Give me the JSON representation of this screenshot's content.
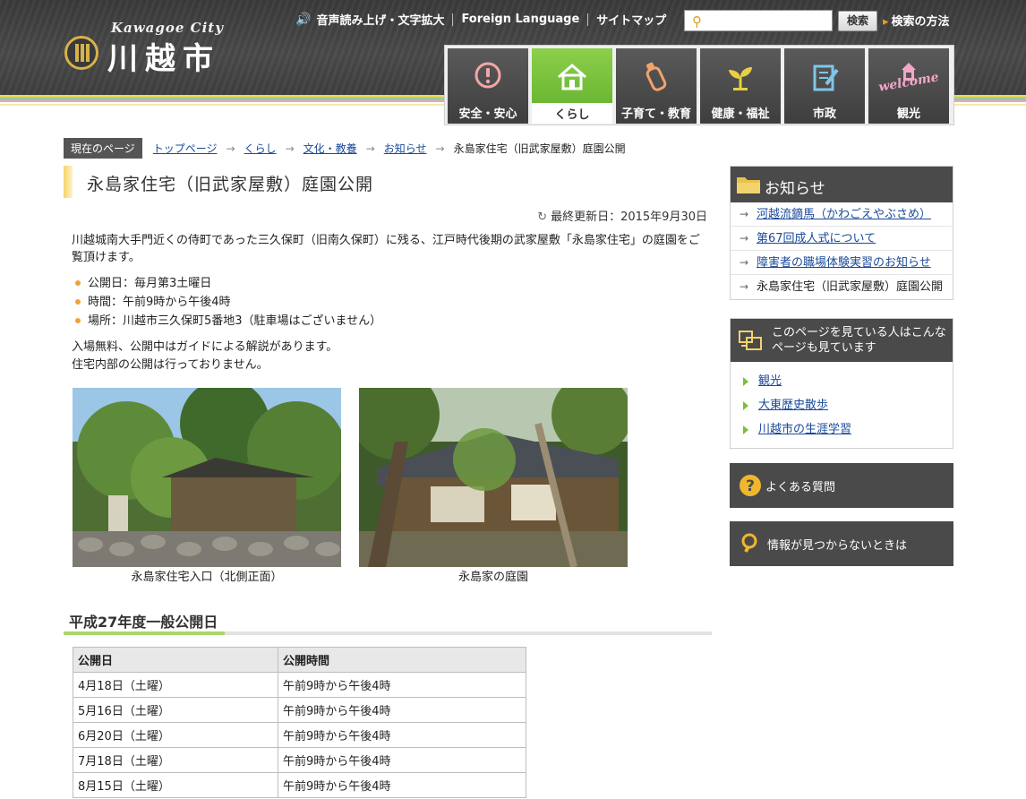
{
  "header": {
    "logo_en": "Kawagoe City",
    "logo_ja": "川越市",
    "util_links": [
      "音声読み上げ・文字拡大",
      "Foreign Language",
      "サイトマップ"
    ],
    "search_placeholder": "",
    "search_button": "検索",
    "search_help": "検索の方法"
  },
  "nav": [
    {
      "label": "安全・安心",
      "icon": "exclamation-icon"
    },
    {
      "label": "くらし",
      "icon": "house-icon",
      "active": true
    },
    {
      "label": "子育て・教育",
      "icon": "baby-bottle-icon"
    },
    {
      "label": "健康・福祉",
      "icon": "sprout-icon"
    },
    {
      "label": "市政",
      "icon": "document-pen-icon"
    },
    {
      "label": "観光",
      "icon": "bell-tower-icon",
      "badge": "welcome"
    }
  ],
  "breadcrumb": {
    "here_label": "現在のページ",
    "items": [
      "トップページ",
      "くらし",
      "文化・教養",
      "お知らせ"
    ],
    "current": "永島家住宅（旧武家屋敷）庭園公開"
  },
  "main": {
    "title": "永島家住宅（旧武家屋敷）庭園公開",
    "updated": "最終更新日：2015年9月30日",
    "intro": "川越城南大手門近くの侍町であった三久保町（旧南久保町）に残る、江戸時代後期の武家屋敷「永島家住宅」の庭園をご覧頂けます。",
    "bullets": [
      "公開日：毎月第3土曜日",
      "時間：午前9時から午後4時",
      "場所：川越市三久保町5番地3（駐車場はございません）"
    ],
    "notes": [
      "入場無料、公開中はガイドによる解説があります。",
      "住宅内部の公開は行っておりません。"
    ],
    "photos": [
      {
        "caption": "永島家住宅入口（北側正面）"
      },
      {
        "caption": "永島家の庭園"
      }
    ],
    "section_title": "平成27年度一般公開日",
    "table": {
      "headers": [
        "公開日",
        "公開時間"
      ],
      "rows": [
        [
          "4月18日（土曜）",
          "午前9時から午後4時"
        ],
        [
          "5月16日（土曜）",
          "午前9時から午後4時"
        ],
        [
          "6月20日（土曜）",
          "午前9時から午後4時"
        ],
        [
          "7月18日（土曜）",
          "午前9時から午後4時"
        ],
        [
          "8月15日（土曜）",
          "午前9時から午後4時"
        ]
      ]
    }
  },
  "sidebar": {
    "news_title": "お知らせ",
    "news": [
      {
        "label": "河越流鏑馬（かわごえやぶさめ）",
        "link": true
      },
      {
        "label": "第67回成人式について",
        "link": true
      },
      {
        "label": "障害者の職場体験実習のお知らせ",
        "link": true
      },
      {
        "label": "永島家住宅（旧武家屋敷）庭園公開",
        "link": false
      }
    ],
    "also_title": "このページを見ている人はこんなページも見ています",
    "also": [
      "観光",
      "大東歴史散歩",
      "川越市の生涯学習"
    ],
    "faq": "よくある質問",
    "notfound": "情報が見つからないときは"
  },
  "colors": {
    "accent_green": "#7cbf3a",
    "bullet_orange": "#f0a23a",
    "header_dark": "#3f3f3f"
  }
}
